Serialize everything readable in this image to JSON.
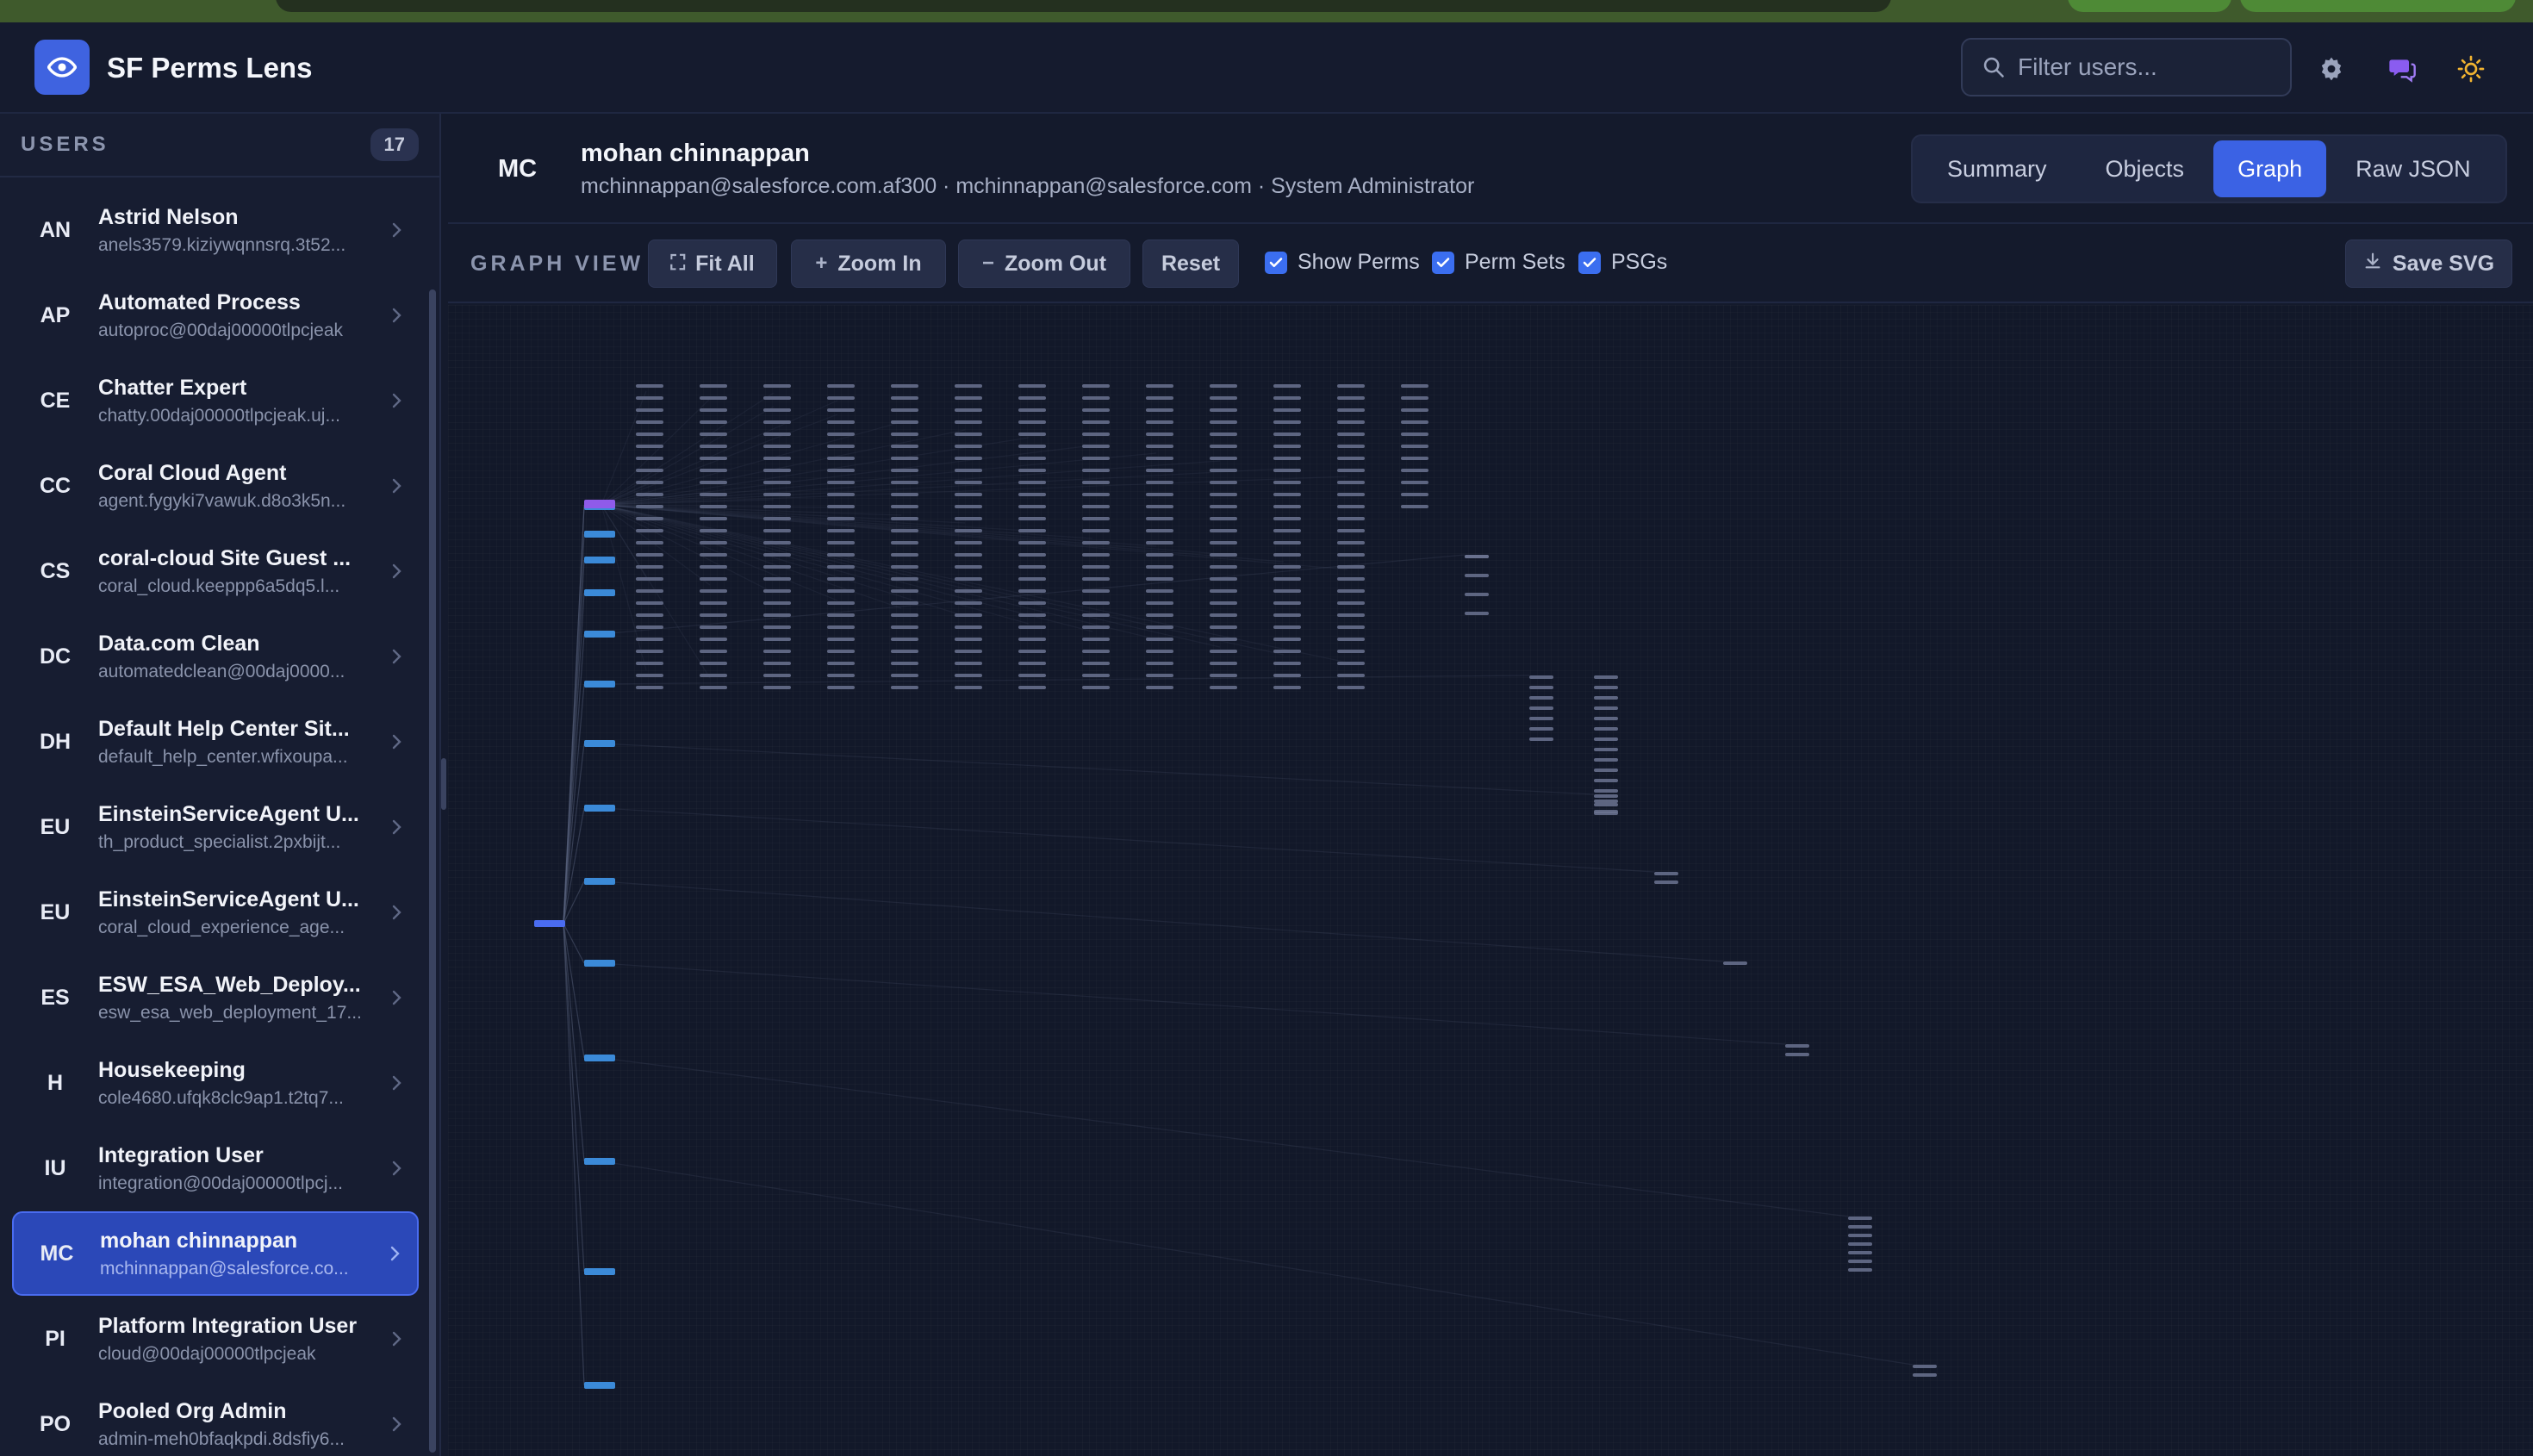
{
  "app": {
    "title": "SF Perms Lens"
  },
  "search": {
    "placeholder": "Filter users..."
  },
  "sidebar": {
    "label": "USERS",
    "count": "17",
    "users": [
      {
        "initials": "AN",
        "name": "Astrid Nelson",
        "email": "anels3579.kiziywqnnsrq.3t52..."
      },
      {
        "initials": "AP",
        "name": "Automated Process",
        "email": "autoproc@00daj00000tlpcjeak"
      },
      {
        "initials": "CE",
        "name": "Chatter Expert",
        "email": "chatty.00daj00000tlpcjeak.uj..."
      },
      {
        "initials": "CC",
        "name": "Coral Cloud Agent",
        "email": "agent.fygyki7vawuk.d8o3k5n..."
      },
      {
        "initials": "CS",
        "name": "coral-cloud Site Guest ...",
        "email": "coral_cloud.keeppp6a5dq5.l..."
      },
      {
        "initials": "DC",
        "name": "Data.com Clean",
        "email": "automatedclean@00daj0000..."
      },
      {
        "initials": "DH",
        "name": "Default Help Center Sit...",
        "email": "default_help_center.wfixoupa..."
      },
      {
        "initials": "EU",
        "name": "EinsteinServiceAgent U...",
        "email": "th_product_specialist.2pxbijt..."
      },
      {
        "initials": "EU",
        "name": "EinsteinServiceAgent U...",
        "email": "coral_cloud_experience_age..."
      },
      {
        "initials": "ES",
        "name": "ESW_ESA_Web_Deploy...",
        "email": "esw_esa_web_deployment_17..."
      },
      {
        "initials": "H",
        "name": "Housekeeping",
        "email": "cole4680.ufqk8clc9ap1.t2tq7..."
      },
      {
        "initials": "IU",
        "name": "Integration User",
        "email": "integration@00daj00000tlpcj..."
      },
      {
        "initials": "MC",
        "name": "mohan chinnappan",
        "email": "mchinnappan@salesforce.co...",
        "active": true
      },
      {
        "initials": "PI",
        "name": "Platform Integration User",
        "email": "cloud@00daj00000tlpcjeak"
      },
      {
        "initials": "PO",
        "name": "Pooled Org Admin",
        "email": "admin-meh0bfaqkpdi.8dsfiy6..."
      }
    ]
  },
  "user": {
    "initials": "MC",
    "name": "mohan chinnappan",
    "meta": "mchinnappan@salesforce.com.af300 · mchinnappan@salesforce.com · System Administrator"
  },
  "tabs": [
    "Summary",
    "Objects",
    "Graph",
    "Raw JSON"
  ],
  "active_tab": "Graph",
  "toolbar": {
    "label": "GRAPH VIEW",
    "fit_all": "Fit All",
    "zoom_in": "Zoom In",
    "zoom_out": "Zoom Out",
    "reset": "Reset",
    "show_perms": "Show Perms",
    "perm_sets": "Perm Sets",
    "psgs": "PSGs",
    "save_svg": "Save SVG",
    "show_perms_checked": true,
    "perm_sets_checked": true,
    "psgs_checked": true
  },
  "colors": {
    "accent": "#3b62e4",
    "user_node": "#4a6cf0",
    "profile_node": "#8f5bea",
    "permset_node": "#3b8ad8",
    "perm_node": "#6b7390"
  }
}
